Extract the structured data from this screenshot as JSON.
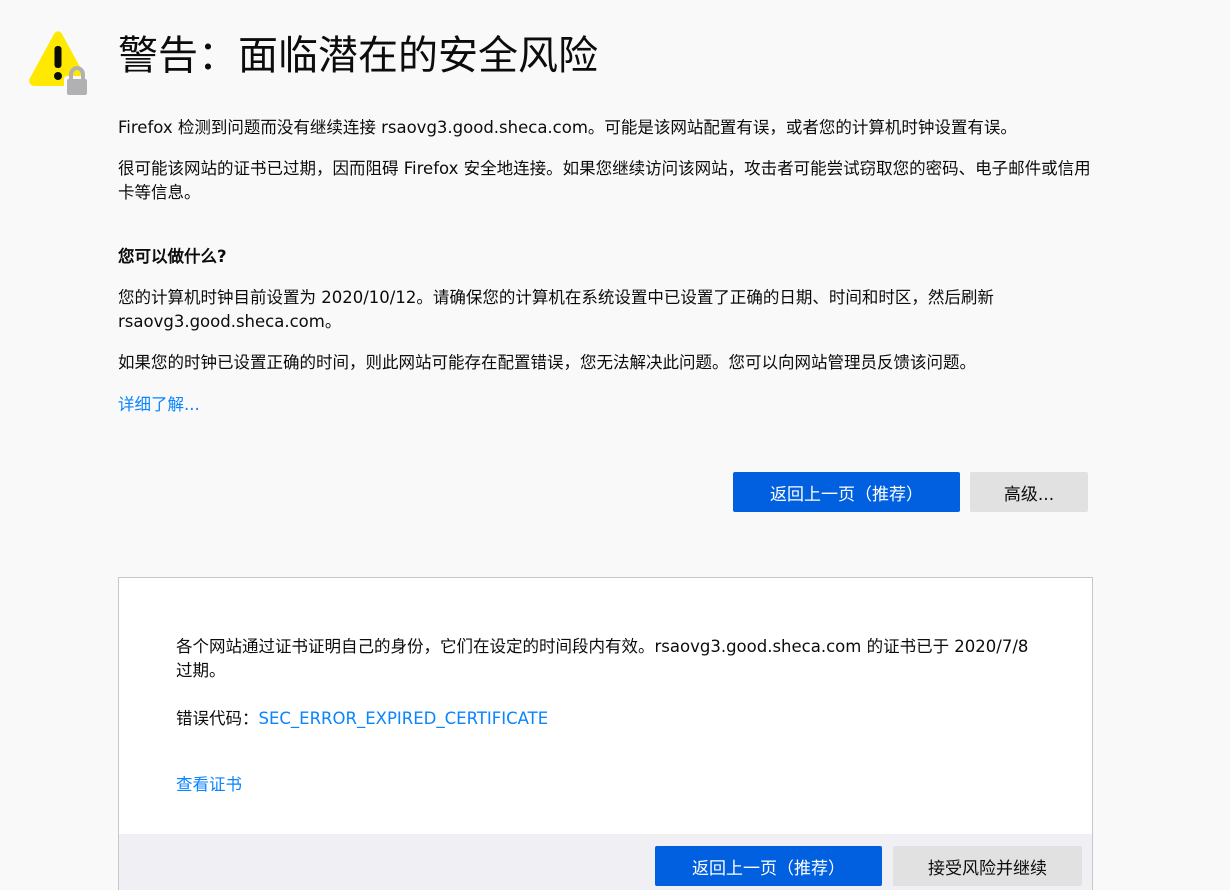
{
  "header": {
    "title": "警告：面临潜在的安全风险",
    "icon": "warning-lock-icon"
  },
  "intro": {
    "paragraph1": "Firefox 检测到问题而没有继续连接 rsaovg3.good.sheca.com。可能是该网站配置有误，或者您的计算机时钟设置有误。",
    "paragraph2": "很可能该网站的证书已过期，因而阻碍 Firefox 安全地连接。如果您继续访问该网站，攻击者可能尝试窃取您的密码、电子邮件或信用卡等信息。"
  },
  "what_to_do": {
    "heading": "您可以做什么?",
    "paragraph1": "您的计算机时钟目前设置为 2020/10/12。请确保您的计算机在系统设置中已设置了正确的日期、时间和时区，然后刷新 rsaovg3.good.sheca.com。",
    "paragraph2": "如果您的时钟已设置正确的时间，则此网站可能存在配置错误，您无法解决此问题。您可以向网站管理员反馈该问题。",
    "learn_more": "详细了解..."
  },
  "buttons": {
    "go_back": "返回上一页（推荐）",
    "advanced": "高级..."
  },
  "advanced_panel": {
    "description": "各个网站通过证书证明自己的身份，它们在设定的时间段内有效。rsaovg3.good.sheca.com 的证书已于 2020/7/8 过期。",
    "error_code_label": "错误代码：",
    "error_code": "SEC_ERROR_EXPIRED_CERTIFICATE",
    "view_certificate": "查看证书",
    "go_back": "返回上一页（推荐）",
    "accept_risk": "接受风险并继续"
  },
  "colors": {
    "primary_button": "#0060df",
    "link": "#0a84ff",
    "warning_yellow": "#ffe900",
    "background": "#f9f9fa"
  }
}
